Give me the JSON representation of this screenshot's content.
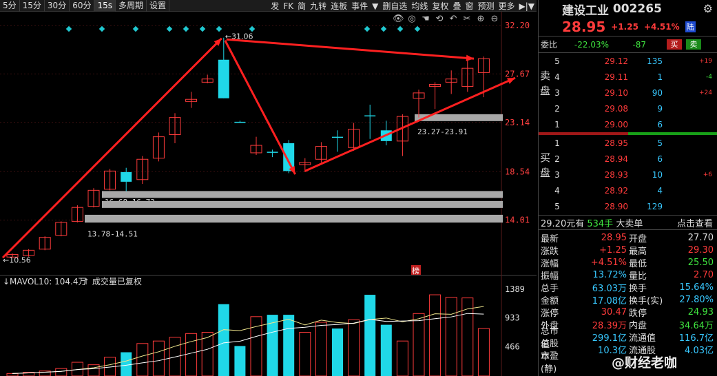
{
  "toolbar": {
    "periods": [
      "5分",
      "15分",
      "30分",
      "60分",
      "15s",
      "多周期",
      "设置"
    ],
    "active_index": 4,
    "right_items": [
      "发",
      "FK",
      "简",
      "九转",
      "连板",
      "事件",
      "▼",
      "删自选",
      "均线",
      "复权",
      "叠",
      "窗",
      "预测",
      "更多"
    ]
  },
  "stock": {
    "name": "建设工业",
    "code": "002265",
    "price": "28.95",
    "change": "+1.25",
    "change_pct": "+4.51%",
    "market_badge": "陆"
  },
  "weibi": {
    "label": "委比",
    "ratio": "-22.03%",
    "diff": "-87",
    "buy_btn": "买",
    "sell_btn": "卖"
  },
  "asks": [
    {
      "n": "5",
      "price": "29.12",
      "qty": "135",
      "delta": "+19"
    },
    {
      "n": "4",
      "price": "29.11",
      "qty": "1",
      "delta": "-4"
    },
    {
      "n": "3",
      "price": "29.10",
      "qty": "90",
      "delta": "+24"
    },
    {
      "n": "2",
      "price": "29.08",
      "qty": "9",
      "delta": ""
    },
    {
      "n": "1",
      "price": "29.00",
      "qty": "6",
      "delta": ""
    }
  ],
  "bids": [
    {
      "n": "1",
      "price": "28.95",
      "qty": "5",
      "delta": ""
    },
    {
      "n": "2",
      "price": "28.94",
      "qty": "6",
      "delta": ""
    },
    {
      "n": "3",
      "price": "28.93",
      "qty": "10",
      "delta": "+6"
    },
    {
      "n": "4",
      "price": "28.92",
      "qty": "4",
      "delta": ""
    },
    {
      "n": "5",
      "price": "28.90",
      "qty": "129",
      "delta": ""
    }
  ],
  "ask_label": "卖盘",
  "bid_label": "买盘",
  "trade": {
    "amount": "29.20元有",
    "hand": "534手",
    "big": "大卖单",
    "link": "点击查看"
  },
  "stats": [
    {
      "k": "最新",
      "v": "28.95",
      "vc": "red",
      "k2": "开盘",
      "v2": "27.70",
      "v2c": "wht"
    },
    {
      "k": "涨跌",
      "v": "+1.25",
      "vc": "red",
      "k2": "最高",
      "v2": "29.30",
      "v2c": "red"
    },
    {
      "k": "涨幅",
      "v": "+4.51%",
      "vc": "red",
      "k2": "最低",
      "v2": "25.50",
      "v2c": "grn"
    },
    {
      "k": "振幅",
      "v": "13.72%",
      "vc": "cyan",
      "k2": "量比",
      "v2": "2.70",
      "v2c": "red"
    },
    {
      "k": "总手",
      "v": "63.03万",
      "vc": "cyan",
      "k2": "换手",
      "v2": "15.64%",
      "v2c": "cyan"
    },
    {
      "k": "金额",
      "v": "17.08亿",
      "vc": "cyan",
      "k2": "换手(实)",
      "v2": "27.80%",
      "v2c": "cyan"
    },
    {
      "k": "涨停",
      "v": "30.47",
      "vc": "red",
      "k2": "跌停",
      "v2": "24.93",
      "v2c": "grn"
    },
    {
      "k": "外盘",
      "v": "28.39万",
      "vc": "red",
      "k2": "内盘",
      "v2": "34.64万",
      "v2c": "grn"
    },
    {
      "k": "总市值",
      "v": "299.1亿",
      "vc": "cyan",
      "k2": "流通值",
      "v2": "116.7亿",
      "v2c": "cyan"
    },
    {
      "k": "总股本",
      "v": "10.3亿",
      "vc": "cyan",
      "k2": "流通股",
      "v2": "4.03亿",
      "v2c": "cyan"
    },
    {
      "k": "市盈(静)",
      "v": "",
      "vc": "cyan",
      "k2": "",
      "v2": "",
      "v2c": "cyan"
    }
  ],
  "watermark": "@财经老咖",
  "chart_data": {
    "type": "candlestick",
    "y_ticks": [
      "32.20",
      "27.67",
      "23.14",
      "18.54",
      "14.01"
    ],
    "y_range": [
      10.0,
      32.2
    ],
    "candles": [
      {
        "o": 10.56,
        "c": 10.8,
        "h": 10.9,
        "l": 10.56,
        "up": true
      },
      {
        "o": 10.7,
        "c": 11.2,
        "h": 11.3,
        "l": 10.6,
        "up": true
      },
      {
        "o": 11.3,
        "c": 12.4,
        "h": 12.5,
        "l": 11.2,
        "up": true
      },
      {
        "o": 12.6,
        "c": 13.8,
        "h": 13.9,
        "l": 12.5,
        "up": true
      },
      {
        "o": 13.9,
        "c": 15.2,
        "h": 15.4,
        "l": 13.8,
        "up": true
      },
      {
        "o": 15.3,
        "c": 16.8,
        "h": 17.0,
        "l": 15.2,
        "up": true
      },
      {
        "o": 16.9,
        "c": 18.6,
        "h": 18.8,
        "l": 16.8,
        "up": true
      },
      {
        "o": 18.5,
        "c": 17.6,
        "h": 18.9,
        "l": 16.7,
        "up": false
      },
      {
        "o": 17.8,
        "c": 19.7,
        "h": 20.0,
        "l": 17.4,
        "up": true
      },
      {
        "o": 19.8,
        "c": 21.8,
        "h": 22.2,
        "l": 19.5,
        "up": true
      },
      {
        "o": 22.0,
        "c": 23.6,
        "h": 24.0,
        "l": 21.2,
        "up": true
      },
      {
        "o": 25.3,
        "c": 25.1,
        "h": 26.0,
        "l": 24.5,
        "up": true
      },
      {
        "o": 26.9,
        "c": 27.2,
        "h": 27.6,
        "l": 26.8,
        "up": true
      },
      {
        "o": 29.0,
        "c": 25.4,
        "h": 31.06,
        "l": 25.4,
        "up": false
      },
      {
        "o": 23.2,
        "c": 23.2,
        "h": 23.3,
        "l": 23.1,
        "up": false
      },
      {
        "o": 20.3,
        "c": 21.0,
        "h": 21.8,
        "l": 20.1,
        "up": true
      },
      {
        "o": 20.4,
        "c": 20.4,
        "h": 20.6,
        "l": 19.9,
        "up": false
      },
      {
        "o": 21.2,
        "c": 18.6,
        "h": 21.5,
        "l": 18.4,
        "up": false
      },
      {
        "o": 19.2,
        "c": 19.4,
        "h": 19.8,
        "l": 18.5,
        "up": true
      },
      {
        "o": 19.7,
        "c": 20.9,
        "h": 21.3,
        "l": 19.4,
        "up": true
      },
      {
        "o": 21.8,
        "c": 21.8,
        "h": 22.4,
        "l": 20.4,
        "up": false
      },
      {
        "o": 20.8,
        "c": 22.5,
        "h": 23.1,
        "l": 20.5,
        "up": true
      },
      {
        "o": 23.8,
        "c": 23.8,
        "h": 24.8,
        "l": 21.6,
        "up": false
      },
      {
        "o": 22.4,
        "c": 21.4,
        "h": 23.3,
        "l": 21.0,
        "up": false
      },
      {
        "o": 21.4,
        "c": 23.7,
        "h": 23.9,
        "l": 20.0,
        "up": true
      },
      {
        "o": 25.4,
        "c": 25.9,
        "h": 26.2,
        "l": 23.6,
        "up": true
      },
      {
        "o": 26.5,
        "c": 26.7,
        "h": 26.9,
        "l": 24.4,
        "up": true
      },
      {
        "o": 26.9,
        "c": 27.2,
        "h": 28.0,
        "l": 25.8,
        "up": true
      },
      {
        "o": 26.5,
        "c": 28.2,
        "h": 29.0,
        "l": 26.0,
        "up": true
      },
      {
        "o": 27.8,
        "c": 29.1,
        "h": 29.3,
        "l": 25.5,
        "up": true
      }
    ],
    "high_label": "31.06",
    "low_label": "10.56",
    "zones": [
      {
        "label": "23.27-23.91",
        "lo": 23.27,
        "hi": 23.91
      },
      {
        "label": "16.68-16.73",
        "lo": 16.68,
        "hi": 16.73
      },
      {
        "label": "15.16-15.80",
        "lo": 15.16,
        "hi": 15.8
      },
      {
        "label": "13.78-14.51",
        "lo": 13.78,
        "hi": 14.51
      }
    ],
    "badge": "榜",
    "volume": {
      "header": "MAVOL10: 104.4万",
      "note": "成交量已复权",
      "y_ticks": [
        "1389",
        "933",
        "466"
      ],
      "y_range": [
        0,
        1389
      ],
      "values": [
        40,
        60,
        80,
        120,
        220,
        180,
        300,
        380,
        520,
        560,
        620,
        680,
        700,
        1150,
        480,
        950,
        980,
        980,
        700,
        860,
        760,
        900,
        1300,
        820,
        560,
        1000,
        1300,
        1260,
        1250,
        760
      ],
      "up": [
        true,
        true,
        true,
        true,
        true,
        true,
        true,
        false,
        true,
        true,
        true,
        true,
        true,
        false,
        false,
        true,
        false,
        false,
        true,
        true,
        false,
        true,
        false,
        false,
        true,
        true,
        true,
        true,
        true,
        true
      ]
    }
  }
}
